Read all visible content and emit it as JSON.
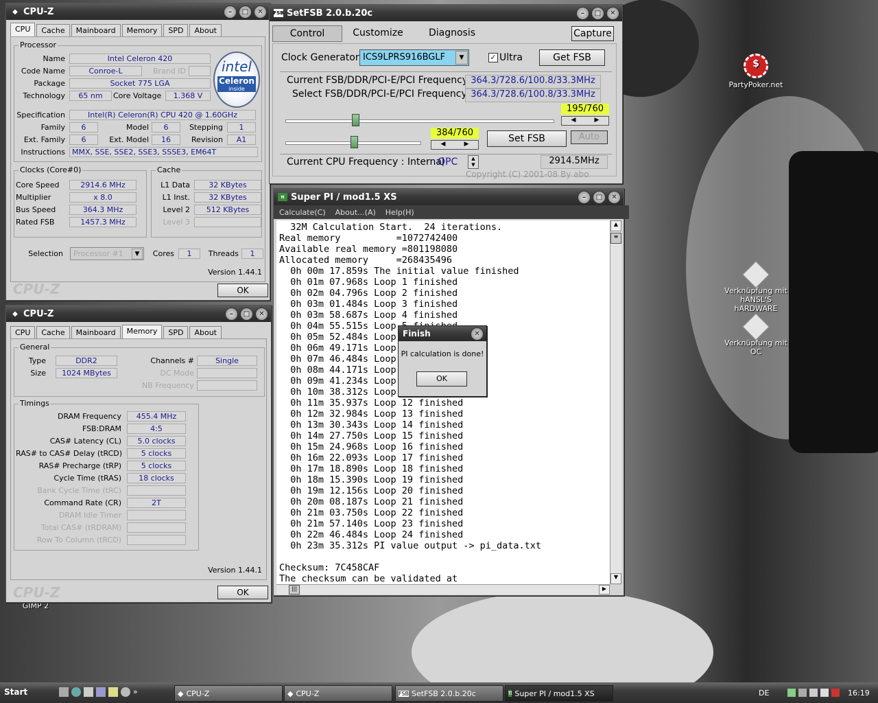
{
  "desktop": {
    "icons": [
      {
        "label": "PartyPoker.net"
      },
      {
        "label": "Verknüpfung mit hANSL'S hARDWARE"
      },
      {
        "label": "Verknüpfung mit OC"
      }
    ],
    "partial_label": "GIMP 2"
  },
  "cpuz1": {
    "title": "CPU-Z",
    "tabs": [
      "CPU",
      "Cache",
      "Mainboard",
      "Memory",
      "SPD",
      "About"
    ],
    "processor_group": "Processor",
    "name_lbl": "Name",
    "name": "Intel Celeron 420",
    "code_lbl": "Code Name",
    "code": "Conroe-L",
    "brand_lbl": "Brand ID",
    "package_lbl": "Package",
    "package": "Socket 775 LGA",
    "tech_lbl": "Technology",
    "tech": "65 nm",
    "cv_lbl": "Core Voltage",
    "cv": "1.368 V",
    "spec_lbl": "Specification",
    "spec": "Intel(R) Celeron(R) CPU      420  @ 1.60GHz",
    "family_lbl": "Family",
    "family": "6",
    "model_lbl": "Model",
    "model": "6",
    "stepping_lbl": "Stepping",
    "stepping": "1",
    "extfam_lbl": "Ext. Family",
    "extfam": "6",
    "extmod_lbl": "Ext. Model",
    "extmod": "16",
    "rev_lbl": "Revision",
    "rev": "A1",
    "instr_lbl": "Instructions",
    "instr": "MMX, SSE, SSE2, SSE3, SSSE3, EM64T",
    "intel_logo_top": "intel",
    "intel_logo_mid": "Celeron",
    "intel_logo_bot": "inside",
    "clocks_group": "Clocks (Core#0)",
    "core_speed_lbl": "Core Speed",
    "core_speed": "2914.6 MHz",
    "mult_lbl": "Multiplier",
    "mult": "x 8.0",
    "bus_lbl": "Bus Speed",
    "bus": "364.3 MHz",
    "rfsb_lbl": "Rated FSB",
    "rfsb": "1457.3 MHz",
    "cache_group": "Cache",
    "l1d_lbl": "L1 Data",
    "l1d": "32 KBytes",
    "l1i_lbl": "L1 Inst.",
    "l1i": "32 KBytes",
    "l2_lbl": "Level 2",
    "l2": "512 KBytes",
    "l3_lbl": "Level 3",
    "sel_lbl": "Selection",
    "sel": "Processor #1",
    "cores_lbl": "Cores",
    "cores": "1",
    "threads_lbl": "Threads",
    "threads": "1",
    "version": "Version 1.44.1",
    "watermark": "CPU-Z",
    "ok": "OK"
  },
  "cpuz2": {
    "title": "CPU-Z",
    "tabs": [
      "CPU",
      "Cache",
      "Mainboard",
      "Memory",
      "SPD",
      "About"
    ],
    "general_group": "General",
    "type_lbl": "Type",
    "type": "DDR2",
    "size_lbl": "Size",
    "size": "1024 MBytes",
    "channels_lbl": "Channels #",
    "channels": "Single",
    "dcmode_lbl": "DC Mode",
    "nbfreq_lbl": "NB Frequency",
    "timings_group": "Timings",
    "timings": [
      {
        "label": "DRAM Frequency",
        "value": "455.4 MHz",
        "dim": false
      },
      {
        "label": "FSB:DRAM",
        "value": "4:5",
        "dim": false
      },
      {
        "label": "CAS# Latency (CL)",
        "value": "5.0 clocks",
        "dim": false
      },
      {
        "label": "RAS# to CAS# Delay (tRCD)",
        "value": "5 clocks",
        "dim": false
      },
      {
        "label": "RAS# Precharge (tRP)",
        "value": "5 clocks",
        "dim": false
      },
      {
        "label": "Cycle Time (tRAS)",
        "value": "18 clocks",
        "dim": false
      },
      {
        "label": "Bank Cycle Time (tRC)",
        "value": "",
        "dim": true
      },
      {
        "label": "Command Rate (CR)",
        "value": "2T",
        "dim": false
      },
      {
        "label": "DRAM Idle Timer",
        "value": "",
        "dim": true
      },
      {
        "label": "Total CAS# (tRDRAM)",
        "value": "",
        "dim": true
      },
      {
        "label": "Row To Column (tRCD)",
        "value": "",
        "dim": true
      }
    ],
    "version": "Version 1.44.1",
    "watermark": "CPU-Z",
    "ok": "OK"
  },
  "setfsb": {
    "title": "SetFSB 2.0.b.20c",
    "tabs": [
      "Control",
      "Customize",
      "Diagnosis"
    ],
    "capture": "Capture",
    "clockgen_lbl": "Clock Generator",
    "clockgen": "ICS9LPRS916BGLF",
    "ultra_lbl": "Ultra",
    "getfsb": "Get FSB",
    "cur_lbl": "Current FSB/DDR/PCI-E/PCI Frequency",
    "cur_val": "364.3/728.6/100.8/33.3MHz",
    "sel_lbl": "Select FSB/DDR/PCI-E/PCI Frequency",
    "sel_val": "364.3/728.6/100.8/33.3MHz",
    "slider1_readout": "195/760",
    "slider1_level": 0.26,
    "slider2_readout": "384/760",
    "slider2_level": 0.505,
    "setfsb_btn": "Set FSB",
    "auto_btn": "Auto",
    "cpufreq_lbl": "Current CPU Frequency : Internal",
    "qpc": "QPC",
    "cpufreq": "2914.5MHz",
    "copyright": "Copyright (C) 2001-08 By abo"
  },
  "superpi": {
    "title": "Super PI / mod1.5 XS",
    "menu": [
      "Calculate(C)",
      "About...(A)",
      "Help(H)"
    ],
    "lines": [
      "  32M Calculation Start.  24 iterations.",
      "Real memory          =1072742400",
      "Available real memory =801198080",
      "Allocated memory     =268435496",
      "  0h 00m 17.859s The initial value finished",
      "  0h 01m 07.968s Loop 1 finished",
      "  0h 02m 04.796s Loop 2 finished",
      "  0h 03m 01.484s Loop 3 finished",
      "  0h 03m 58.687s Loop 4 finished",
      "  0h 04m 55.515s Loop 5 finished",
      "  0h 05m 52.484s Loop 6 finished",
      "  0h 06m 49.171s Loop 7 finished",
      "  0h 07m 46.484s Loop 8 finished",
      "  0h 08m 44.171s Loop 9 finished",
      "  0h 09m 41.234s Loop 10 finished",
      "  0h 10m 38.312s Loop 11 finished",
      "  0h 11m 35.937s Loop 12 finished",
      "  0h 12m 32.984s Loop 13 finished",
      "  0h 13m 30.343s Loop 14 finished",
      "  0h 14m 27.750s Loop 15 finished",
      "  0h 15m 24.968s Loop 16 finished",
      "  0h 16m 22.093s Loop 17 finished",
      "  0h 17m 18.890s Loop 18 finished",
      "  0h 18m 15.390s Loop 19 finished",
      "  0h 19m 12.156s Loop 20 finished",
      "  0h 20m 08.187s Loop 21 finished",
      "  0h 21m 03.750s Loop 22 finished",
      "  0h 21m 57.140s Loop 23 finished",
      "  0h 22m 46.484s Loop 24 finished",
      "  0h 23m 35.312s PI value output -> pi_data.txt",
      "",
      "Checksum: 7C458CAF",
      "The checksum can be validated at"
    ]
  },
  "finish": {
    "title": "Finish",
    "message": "PI calculation is done!",
    "ok": "OK"
  },
  "taskbar": {
    "start": "Start",
    "buttons": [
      "CPU-Z",
      "CPU-Z",
      "SetFSB 2.0.b.20c",
      "Super PI / mod1.5 XS"
    ],
    "lang": "DE",
    "clock": "16:19"
  }
}
